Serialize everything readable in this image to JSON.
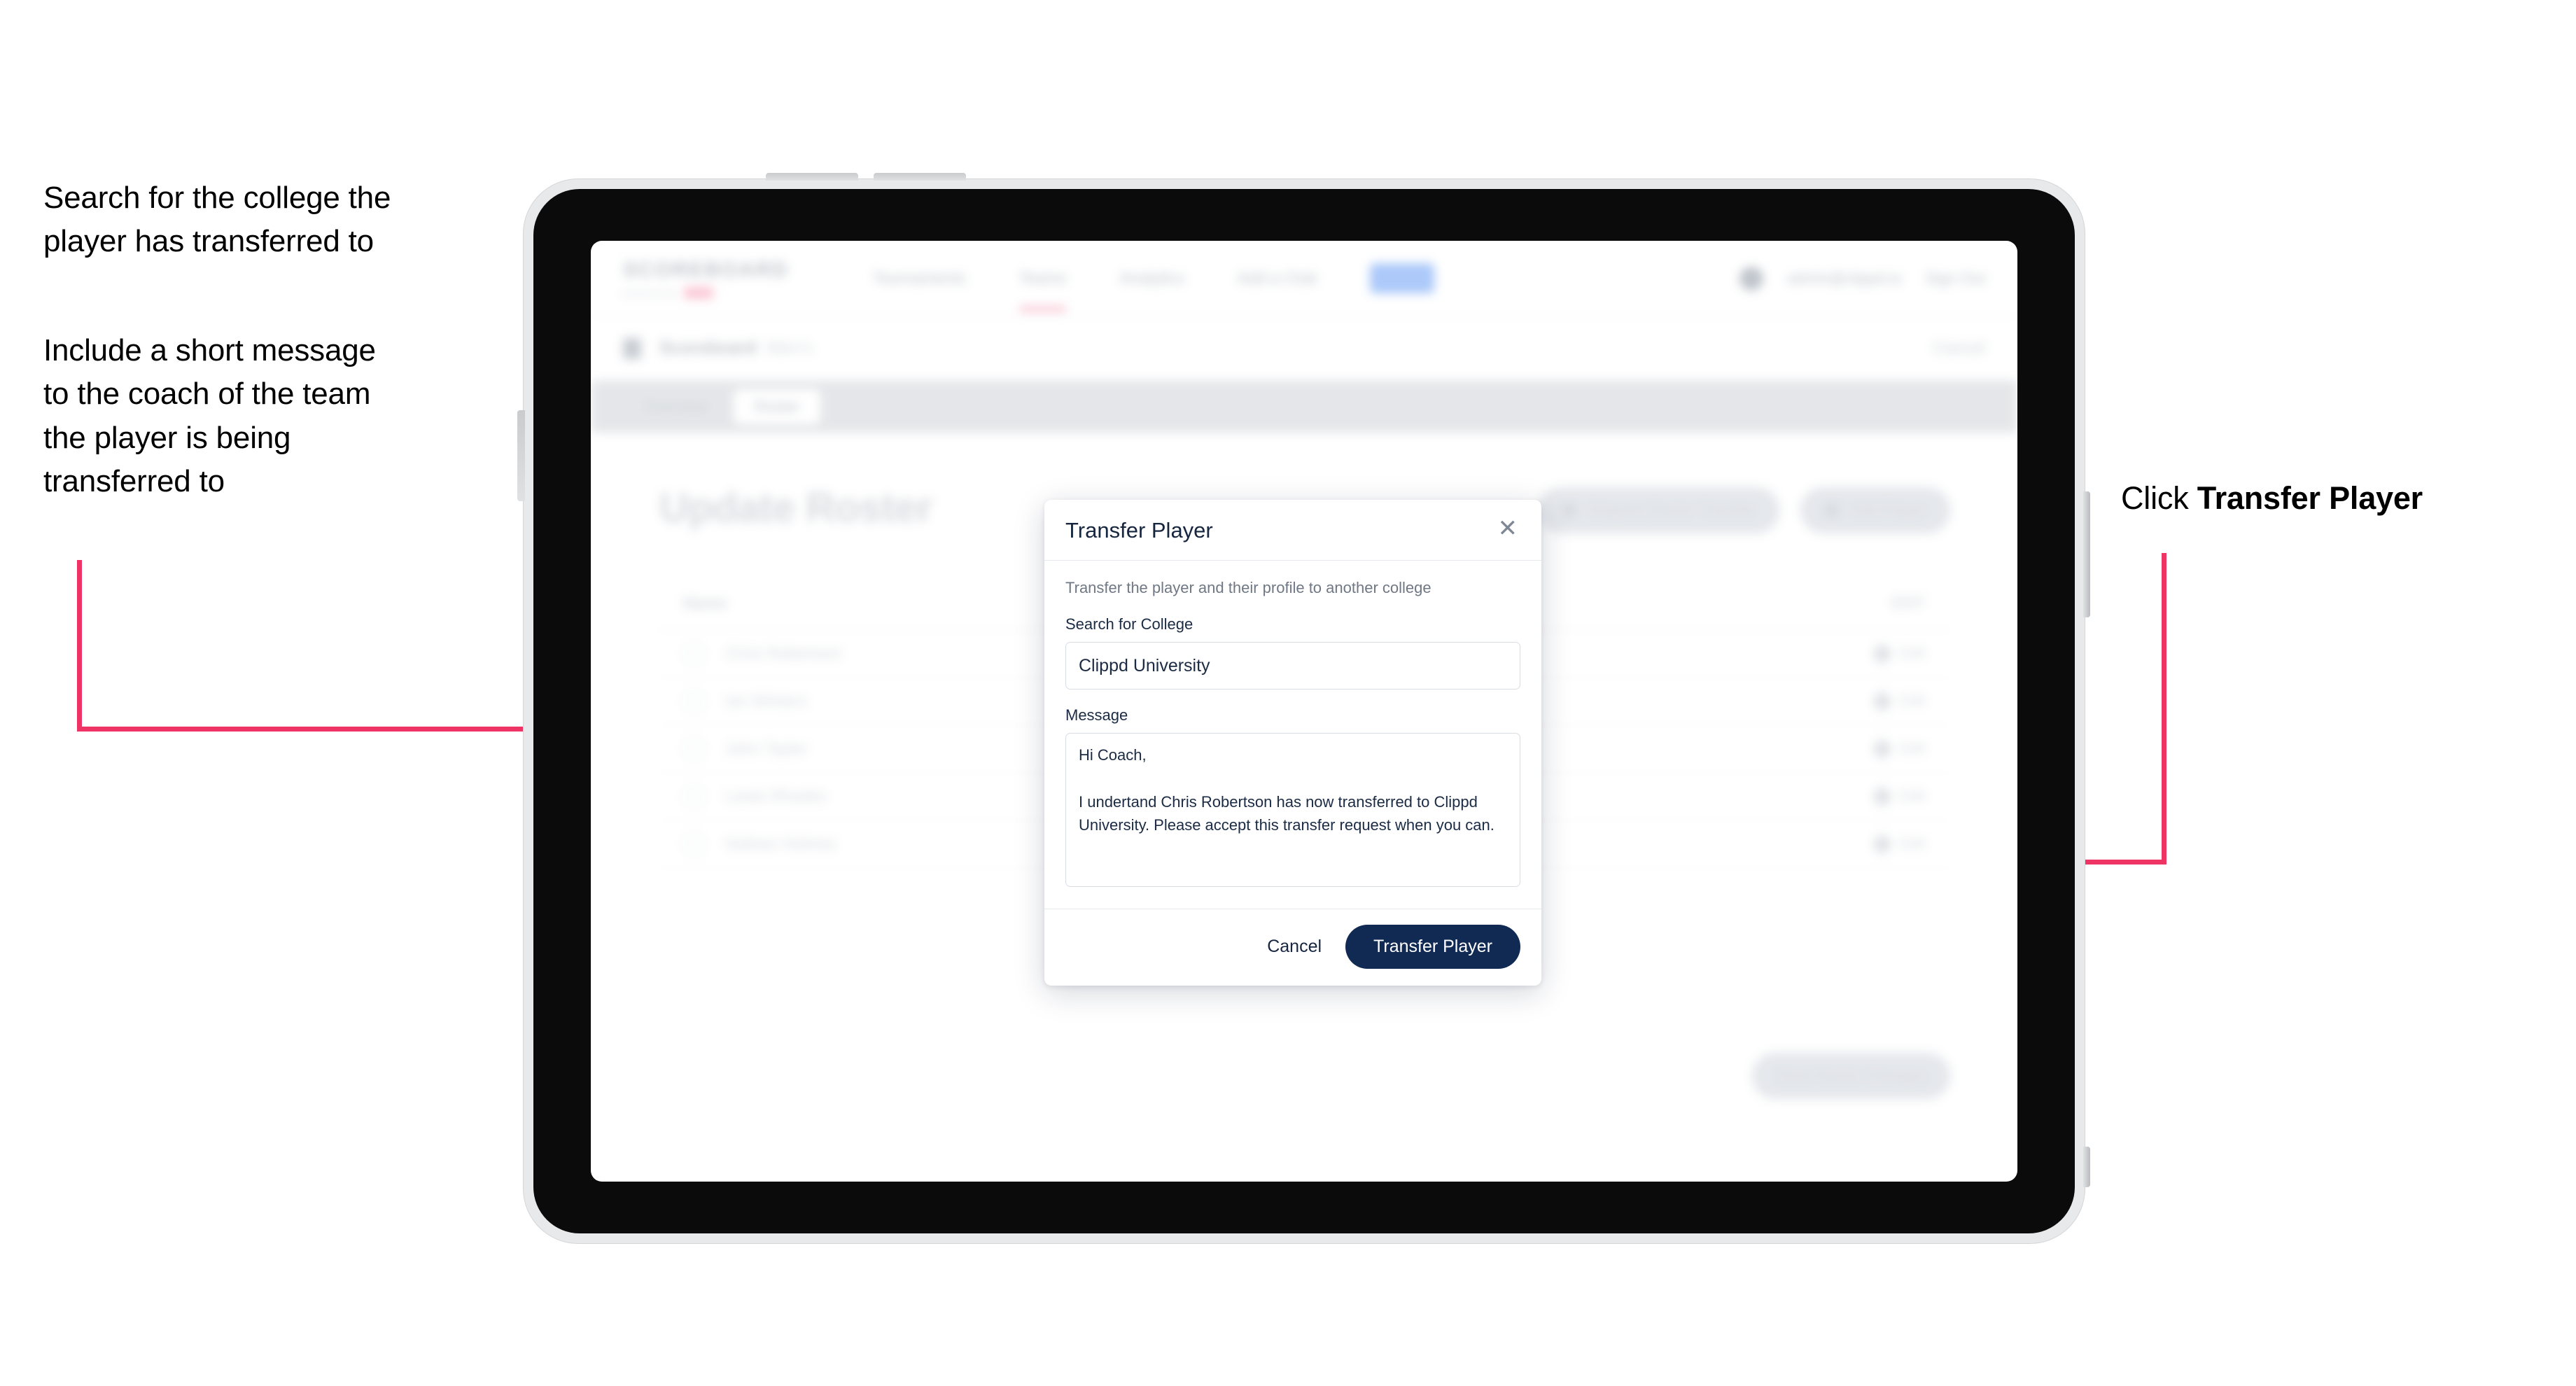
{
  "annotations": {
    "left_1": "Search for the college the\nplayer has transferred to",
    "left_2": "Include a short message\nto the coach of the team\nthe player is being\ntransferred to",
    "right_1_prefix": "Click ",
    "right_1_emphasis": "Transfer Player",
    "arrow_color": "#ee3465"
  },
  "app": {
    "brand": {
      "name": "SCOREBOARD",
      "subtitle": "powered by",
      "badge": ""
    },
    "topnav": {
      "links": [
        {
          "label": "Tournaments",
          "active": false
        },
        {
          "label": "Teams",
          "active": true
        },
        {
          "label": "Analytics",
          "active": false
        },
        {
          "label": "Add a Club",
          "active": false
        }
      ],
      "pill_label": "Club",
      "user_email": "admin@clippd.io",
      "sign_out": "Sign Out"
    },
    "breadcrumb": {
      "icon": "shield-icon",
      "main": "Scoreboard",
      "sub": "Men's",
      "right": "Cancel"
    },
    "tabs": [
      {
        "label": "Overview",
        "active": false
      },
      {
        "label": "Roster",
        "active": true
      }
    ],
    "page_title": "Update Roster",
    "header_actions": [
      {
        "icon": "download-icon",
        "label": "Request Roster Transfer"
      },
      {
        "icon": "plus-icon",
        "label": "Add Player"
      }
    ],
    "roster": {
      "col_name": "Name",
      "col_action": "EDIT",
      "rows": [
        {
          "name": "Chris Robertson",
          "action": "Edit"
        },
        {
          "name": "Ian Winters",
          "action": "Edit"
        },
        {
          "name": "John Taylor",
          "action": "Edit"
        },
        {
          "name": "Lewis Rhodes",
          "action": "Edit"
        },
        {
          "name": "Nathan Holmes",
          "action": "Edit"
        }
      ]
    },
    "footer_action": {
      "label": "Save Roster Changes"
    }
  },
  "modal": {
    "title": "Transfer Player",
    "close_icon": "close-icon",
    "subtitle": "Transfer the player and their profile to another college",
    "college_label": "Search for College",
    "college_value": "Clippd University",
    "college_placeholder": "Search for College",
    "message_label": "Message",
    "message_value": "Hi Coach,\n\nI undertand Chris Robertson has now transferred to Clippd University. Please accept this transfer request when you can.",
    "message_placeholder": "Message",
    "cancel_label": "Cancel",
    "submit_label": "Transfer Player",
    "submit_color": "#102a54"
  }
}
